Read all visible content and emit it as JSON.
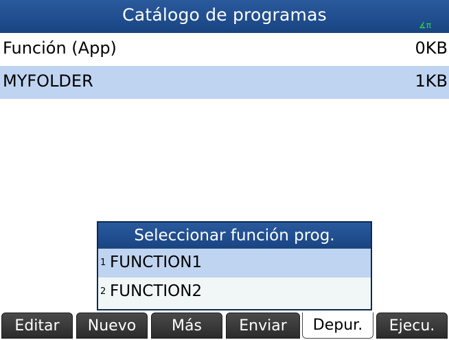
{
  "header": {
    "title": "Catálogo de programas",
    "angle_indicator": "∡π"
  },
  "catalog": {
    "items": [
      {
        "name": "Función (App)",
        "size": "0KB",
        "selected": false
      },
      {
        "name": "MYFOLDER",
        "size": "1KB",
        "selected": true
      }
    ]
  },
  "popup": {
    "title": "Seleccionar función prog.",
    "items": [
      {
        "number": "1",
        "label": "FUNCTION1",
        "selected": true
      },
      {
        "number": "2",
        "label": "FUNCTION2",
        "selected": false
      }
    ]
  },
  "softkeys": [
    {
      "label": "Editar",
      "active": false
    },
    {
      "label": "Nuevo",
      "active": false
    },
    {
      "label": "Más",
      "active": false
    },
    {
      "label": "Enviar",
      "active": false
    },
    {
      "label": "Depur.",
      "active": true
    },
    {
      "label": "Ejecu.",
      "active": false
    }
  ],
  "colors": {
    "header_blue": "#1f4d8e",
    "selection": "#bfd4f0",
    "angle_indicator": "#27e43a"
  }
}
